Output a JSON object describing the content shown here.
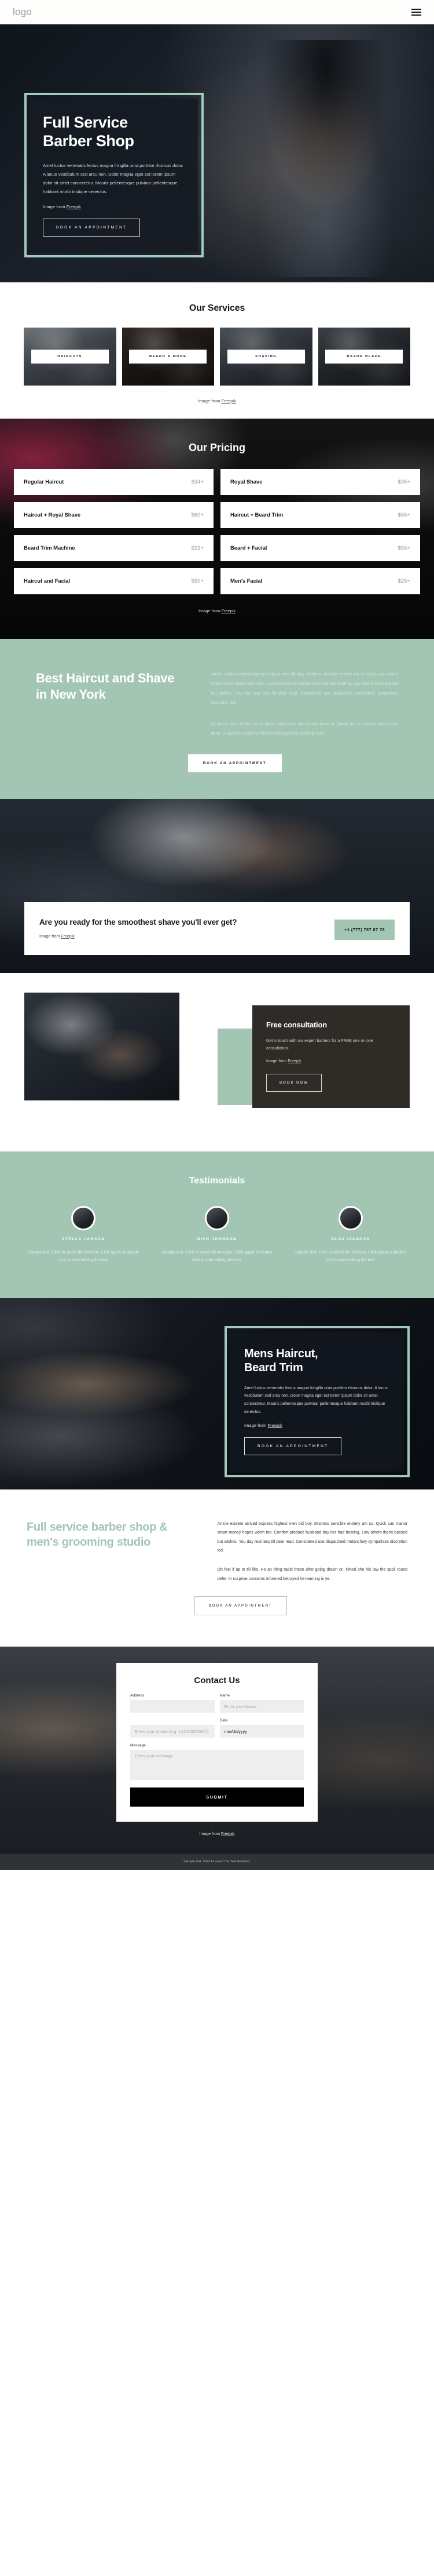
{
  "header": {
    "logo": "logo",
    "menu_icon": "hamburger-icon"
  },
  "hero": {
    "title_line1": "Full Service",
    "title_line2": "Barber Shop",
    "body": "Amet luctus venenatis lectus magna fringilla urna porttitor rhoncus dolor. A lacus vestibulum sed arcu non. Dolor magna eget est lorem ipsum dolor sit amet consectetur. Mauris pellentesque pulvinar pellentesque habitant morbi tristique senectus.",
    "credit_prefix": "Image from ",
    "credit_link": "Freepik",
    "cta": "BOOK AN APPOINTMENT"
  },
  "services": {
    "title": "Our Services",
    "items": [
      {
        "label": "HAIRCUTS"
      },
      {
        "label": "BEARD & MORE"
      },
      {
        "label": "SHAVING"
      },
      {
        "label": "RAZOR BLADE"
      }
    ],
    "credit_prefix": "Image from ",
    "credit_link": "Freepik"
  },
  "pricing": {
    "title": "Our Pricing",
    "left": [
      {
        "name": "Regular Haircut",
        "price": "$34+"
      },
      {
        "name": "Haircut + Royal Shave",
        "price": "$60+"
      },
      {
        "name": "Beard Trim Machine",
        "price": "$23+"
      },
      {
        "name": "Haircut and Facial",
        "price": "$50+"
      }
    ],
    "right": [
      {
        "name": "Royal Shave",
        "price": "$35+"
      },
      {
        "name": "Haircut + Beard Trim",
        "price": "$65+"
      },
      {
        "name": "Beard + Facial",
        "price": "$55+"
      },
      {
        "name": "Men's Facial",
        "price": "$25+"
      }
    ],
    "credit_prefix": "Image from ",
    "credit_link": "Freepik"
  },
  "best": {
    "heading": "Best Haircut and Shave in New York",
    "p1": "Article evident arrived express highest men did boy. Mistress sensible entirely am so. Quick can manor smart money hopes worth too. Comfort produce husband boy her had hearing. Law others theirs passed but wishes. You day real less till dear read. Considered use dispatched melancholy sympathize discretion led.",
    "p2": "Oh feel if up to till like. He an thing rapid these after going drawn or. Timed she his law the spoil round defer. In surprise concerns informed betrayed he learning is ye.",
    "cta": "BOOK AN APPOINTMENT"
  },
  "shave": {
    "heading": "Are you ready for the smoothest shave you'll ever get?",
    "credit_prefix": "Image from ",
    "credit_link": "Freepik",
    "phone": "+1 (777) 787 87 78"
  },
  "consult": {
    "heading": "Free consultation",
    "body": "Get in touch with our expert barbers for a FREE one on one consultation.",
    "credit_prefix": "Image from ",
    "credit_link": "Freepik",
    "cta": "BOOK NOW"
  },
  "testimonials": {
    "title": "Testimonials",
    "items": [
      {
        "name": "STELLA LARSON",
        "text": "Sample text. Click to select the text box. Click again or double click to start editing the text."
      },
      {
        "name": "NICK JHONSON",
        "text": "Sample text. Click to select the text box. Click again or double click to start editing the text."
      },
      {
        "name": "OLGA IVANOVA",
        "text": "Sample text. Click to select the text box. Click again or double click to start editing the text."
      }
    ]
  },
  "mens": {
    "title_line1": "Mens Haircut,",
    "title_line2": "Beard Trim",
    "body": "Amet luctus venenatis lectus magna fringilla urna porttitor rhoncus dolor. A lacus vestibulum sed arcu non. Dolor magna eget est lorem ipsum dolor sit amet consectetur. Mauris pellentesque pulvinar pellentesque habitant morbi tristique senectus.",
    "credit_prefix": "Image from ",
    "credit_link": "Freepik",
    "cta": "BOOK AN APPOINTMENT"
  },
  "fullservice": {
    "heading": "Full service barber shop & men's grooming studio",
    "p1": "Article evident arrived express highest men did boy. Mistress sensible entirely am so. Quick can manor smart money hopes worth too. Comfort produce husband boy her had hearing. Law others theirs passed but wishes. You day real less till dear read. Considered use dispatched melancholy sympathize discretion led.",
    "p2": "Oh feel if up to till like. He an thing rapid these after going drawn or. Timed she his law the spoil round defer. In surprise concerns informed betrayed he learning is ye.",
    "cta": "BOOK AN APPOINTMENT"
  },
  "contact": {
    "title": "Contact Us",
    "address_label": "Address",
    "address_value": "",
    "address_placeholder": "",
    "name_label": "Name",
    "name_placeholder": "Enter your Name",
    "phone_placeholder": "Enter your phone (e.g. +14155552671)",
    "date_label": "Date",
    "date_placeholder": "mm/dd/yyyy",
    "message_label": "Message",
    "message_placeholder": "Enter your message",
    "submit": "SUBMIT",
    "credit_prefix": "Image from ",
    "credit_link": "Freepik"
  },
  "footer": {
    "text": "Sample text. Click to select the Text Element."
  }
}
